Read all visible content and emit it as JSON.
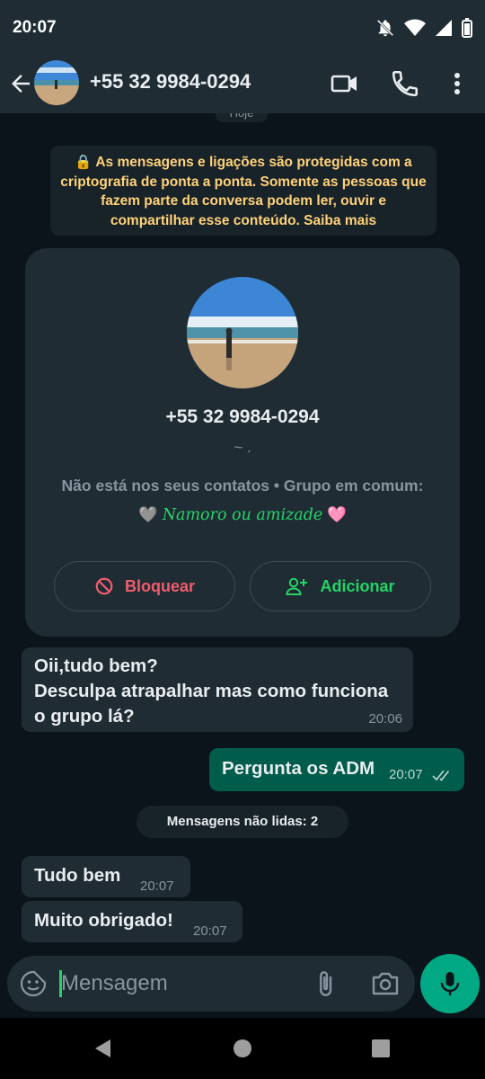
{
  "status": {
    "time": "20:07"
  },
  "header": {
    "contact": "+55 32 9984-0294"
  },
  "chat": {
    "today_label": "Hoje",
    "encryption_notice": "🔒 As mensagens e ligações são protegidas com a criptografia de ponta a ponta. Somente as pessoas que fazem parte da conversa podem ler, ouvir e compartilhar esse conteúdo. Saiba mais",
    "contact_card": {
      "number": "+55 32 9984-0294",
      "about": "~ .",
      "info_prefix": "Não está nos seus contatos • Grupo em comum: 🩶 ",
      "group_name": "Namoro ou amizade",
      "info_suffix": " 🩷",
      "block_label": "Bloquear",
      "add_label": "Adicionar"
    },
    "messages": [
      {
        "lines": [
          "Oii,tudo bem?",
          "Desculpa atrapalhar mas como funciona",
          "o grupo lá?"
        ],
        "time": "20:06",
        "direction": "in"
      },
      {
        "text": "Pergunta os ADM",
        "time": "20:07",
        "direction": "out",
        "status": "delivered"
      },
      {
        "text": "Tudo bem",
        "time": "20:07",
        "direction": "in"
      },
      {
        "text": "Muito obrigado!",
        "time": "20:07",
        "direction": "in"
      }
    ],
    "unread_divider": "Mensagens não lidas: 2"
  },
  "composer": {
    "placeholder": "Mensagem"
  },
  "colors": {
    "accent": "#25d366",
    "outgoing": "#005c4b",
    "incoming": "#1f2c34",
    "danger": "#f15c6d",
    "notice": "#ffd279"
  }
}
